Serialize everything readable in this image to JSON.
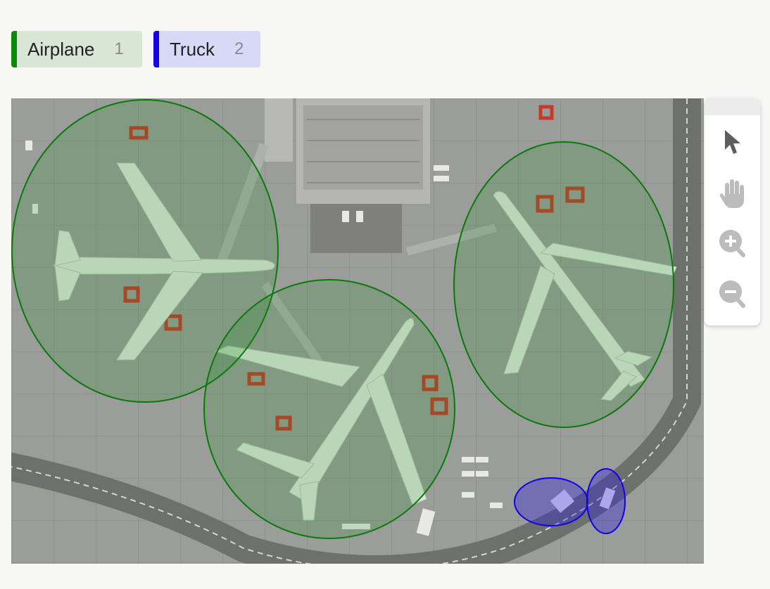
{
  "labels": [
    {
      "name": "Airplane",
      "count": "1",
      "color": "#0a8a0a",
      "bg": "#d9e6d6"
    },
    {
      "name": "Truck",
      "count": "2",
      "color": "#1400e6",
      "bg": "#d8d8f7"
    }
  ],
  "toolbar": {
    "tools": [
      {
        "icon": "pointer-arrow-icon",
        "active": true
      },
      {
        "icon": "hand-pan-icon",
        "active": false
      },
      {
        "icon": "zoom-in-icon",
        "active": false
      },
      {
        "icon": "zoom-out-icon",
        "active": false
      }
    ]
  },
  "annotations": [
    {
      "label": "Airplane",
      "shape": "ellipse"
    },
    {
      "label": "Airplane",
      "shape": "ellipse"
    },
    {
      "label": "Airplane",
      "shape": "ellipse"
    },
    {
      "label": "Truck",
      "shape": "ellipse"
    },
    {
      "label": "Truck",
      "shape": "ellipse"
    }
  ],
  "colors": {
    "airplane_stroke": "#0a7a0a",
    "truck_stroke": "#1400e6",
    "icon_gray": "#bcbcbc",
    "icon_active": "#5e5e5e"
  }
}
